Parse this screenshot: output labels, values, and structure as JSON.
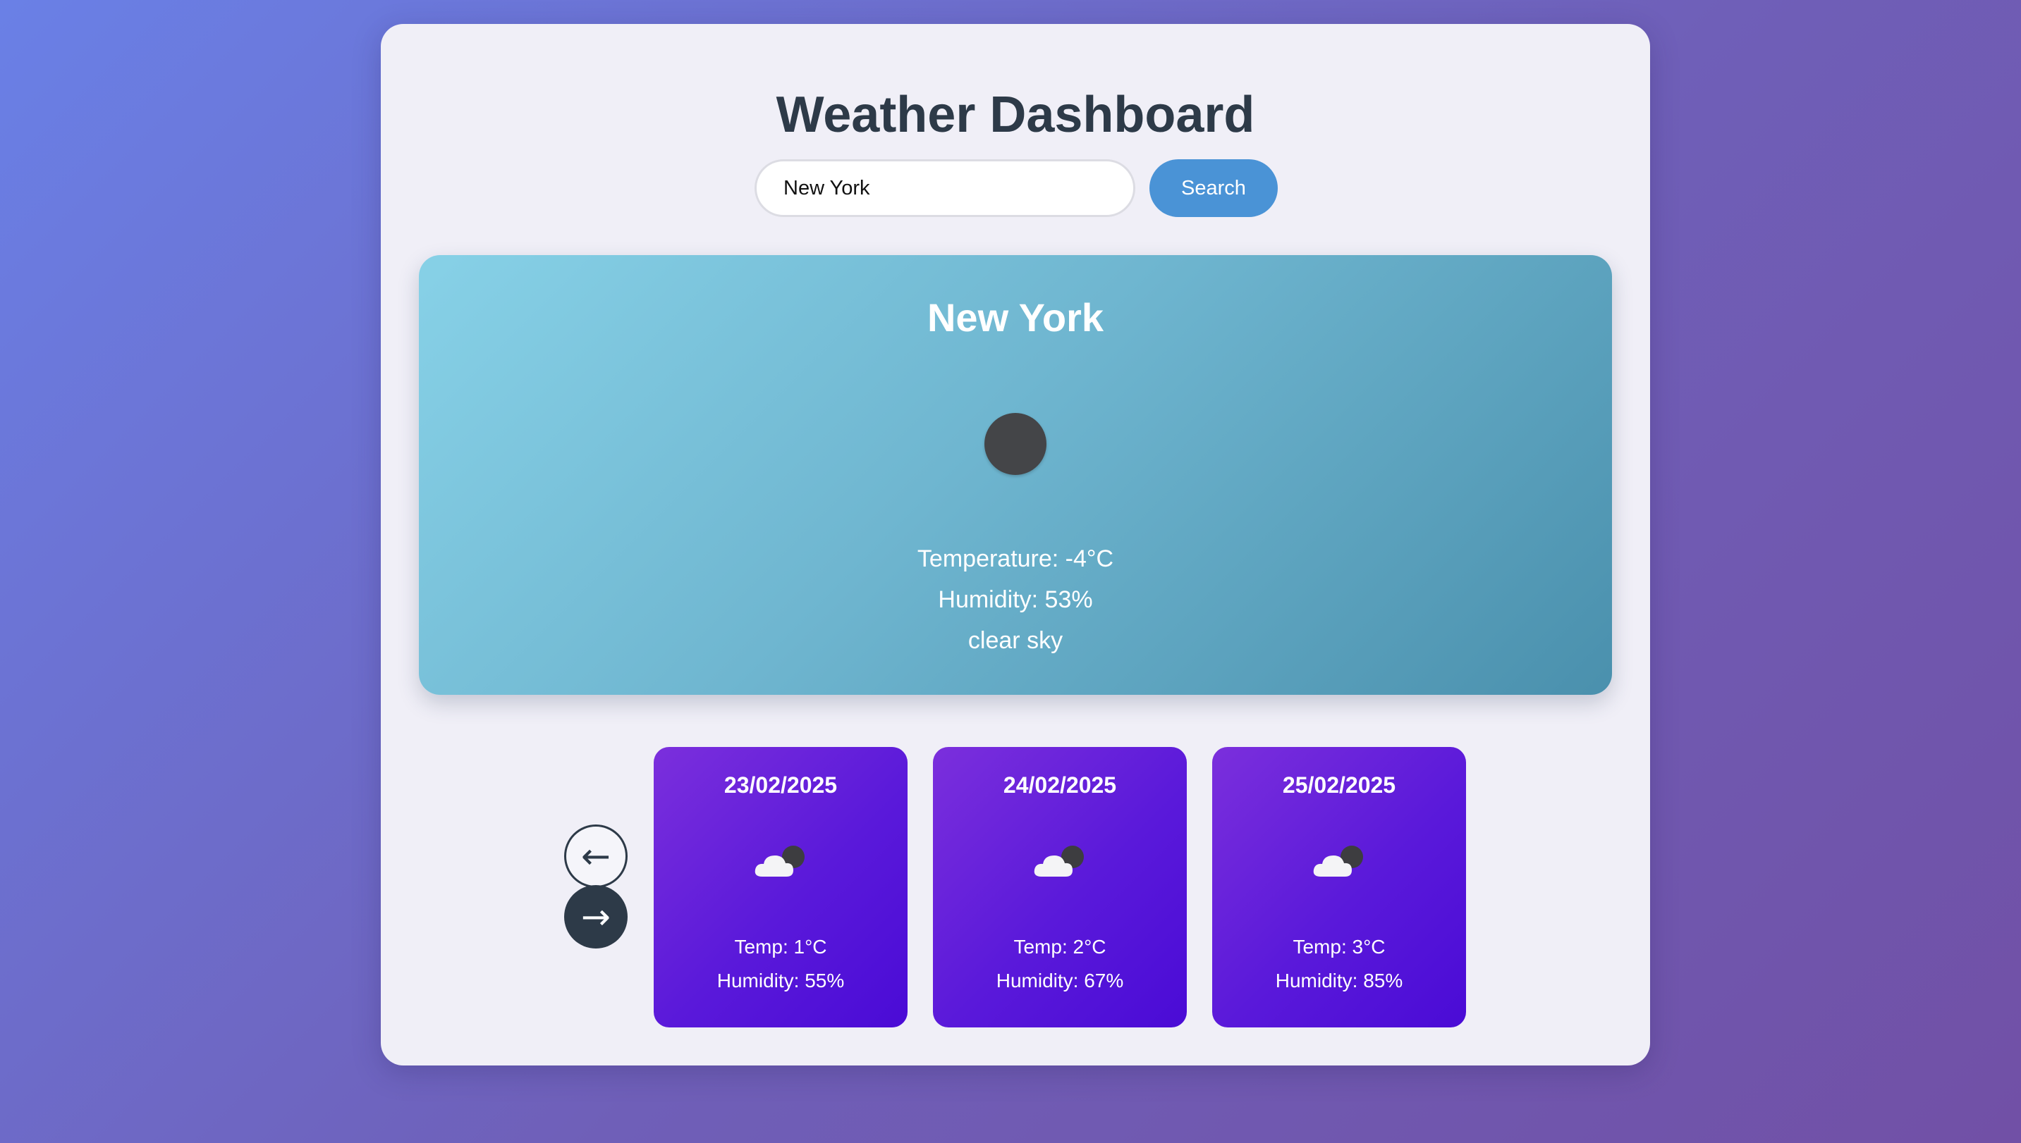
{
  "app": {
    "title": "Weather Dashboard"
  },
  "search": {
    "value": "New York",
    "button_label": "Search"
  },
  "current": {
    "city": "New York",
    "icon": "moon-icon",
    "temperature": "Temperature: -4°C",
    "humidity": "Humidity: 53%",
    "description": "clear sky"
  },
  "forecast": {
    "prev_label": "←",
    "next_label": "→",
    "days": [
      {
        "date": "23/02/2025",
        "icon": "partly-cloudy-icon",
        "temp": "Temp: 1°C",
        "humidity": "Humidity: 55%"
      },
      {
        "date": "24/02/2025",
        "icon": "partly-cloudy-icon",
        "temp": "Temp: 2°C",
        "humidity": "Humidity: 67%"
      },
      {
        "date": "25/02/2025",
        "icon": "partly-cloudy-icon",
        "temp": "Temp: 3°C",
        "humidity": "Humidity: 85%"
      }
    ]
  },
  "colors": {
    "background_start": "#6a80e6",
    "background_end": "#7150a6",
    "panel": "#f0eff7",
    "title_text": "#2d3a48",
    "search_button": "#4a93d6",
    "current_card_start": "#87d1e7",
    "current_card_end": "#4a90ad",
    "forecast_card_start": "#7b2fdc",
    "forecast_card_end": "#4a0bd6"
  }
}
